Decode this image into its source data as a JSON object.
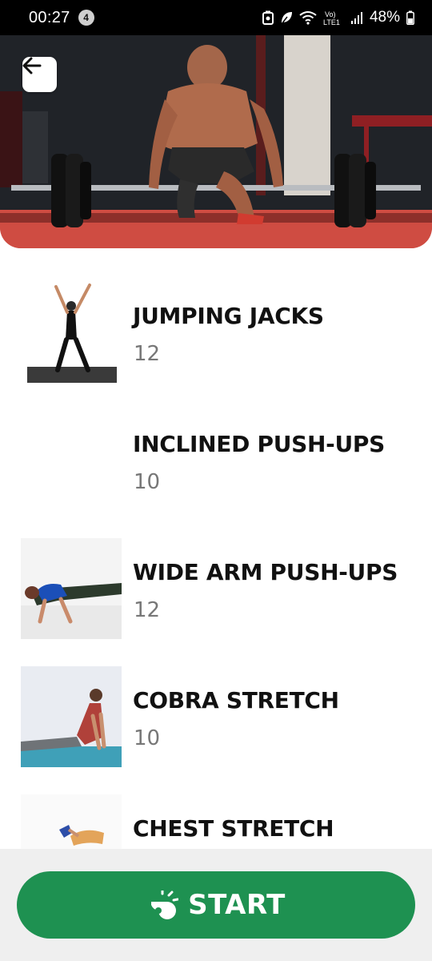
{
  "status_bar": {
    "time": "00:27",
    "notification_count": "4",
    "battery": "48%",
    "icons": [
      "battery-saver-icon",
      "leaf-icon",
      "wifi-icon",
      "volte-icon",
      "signal-icon",
      "battery-icon"
    ]
  },
  "header": {
    "back_icon": "arrow-left-icon"
  },
  "exercises": [
    {
      "name": "JUMPING JACKS",
      "reps": "12"
    },
    {
      "name": "INCLINED PUSH-UPS",
      "reps": "10"
    },
    {
      "name": "WIDE ARM PUSH-UPS",
      "reps": "12"
    },
    {
      "name": "COBRA STRETCH",
      "reps": "10"
    },
    {
      "name": "CHEST STRETCH",
      "reps": ""
    }
  ],
  "start_button": {
    "label": "START",
    "icon": "whistle-icon",
    "color": "#1e9151"
  }
}
